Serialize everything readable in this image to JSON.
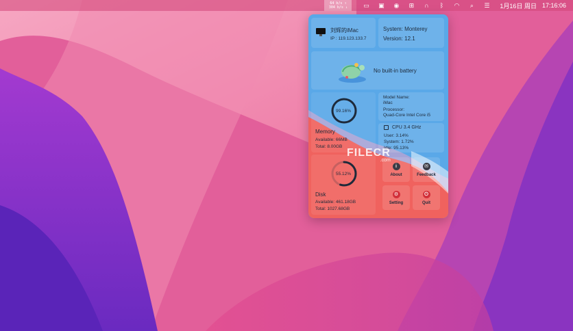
{
  "menubar": {
    "net_up": "64 b/s ↑",
    "net_down": "304 b/s ↓",
    "icons": [
      "screen-mirror-icon",
      "photo-icon",
      "monitor-app-icon",
      "grid-icon",
      "headphones-icon",
      "bluetooth-icon",
      "wifi-icon",
      "search-icon",
      "control-center-icon"
    ],
    "date": "1月16日 周日",
    "time": "17:16:06"
  },
  "device": {
    "name": "刘辉的iMac",
    "ip": "IP : 119.123.133.7"
  },
  "system": {
    "os": "System: Monterey",
    "version": "Version: 12.1"
  },
  "battery": {
    "label": "No built-in battery"
  },
  "memory": {
    "percent_text": "99.16%",
    "percent": 99.16,
    "title": "Memory",
    "available": "Available: 66MB",
    "total": "Total: 8.00GB"
  },
  "model": {
    "name_label": "Model Name:",
    "name_value": "iMac",
    "processor_label": "Processor:",
    "processor_value": "Quad-Core Intel Core i5"
  },
  "cpu": {
    "title": "CPU  3.4 GHz",
    "user": "User:   3.14%",
    "system": "System:   1.72%",
    "idle": "Idle:   95.13%"
  },
  "disk": {
    "percent_text": "55.12%",
    "percent": 55.12,
    "title": "Disk",
    "available": "Available: 461.18GB",
    "total": "Total: 1027.68GB"
  },
  "buttons": {
    "about": "About",
    "feedback": "Feedback",
    "setting": "Setting",
    "quit": "Quit"
  },
  "watermark": {
    "text": "FILECR",
    "sub": ".com"
  },
  "colors": {
    "panel_blue": "#59a7e6",
    "panel_red": "#f0625e",
    "ring_dark": "#1e2a3a"
  }
}
